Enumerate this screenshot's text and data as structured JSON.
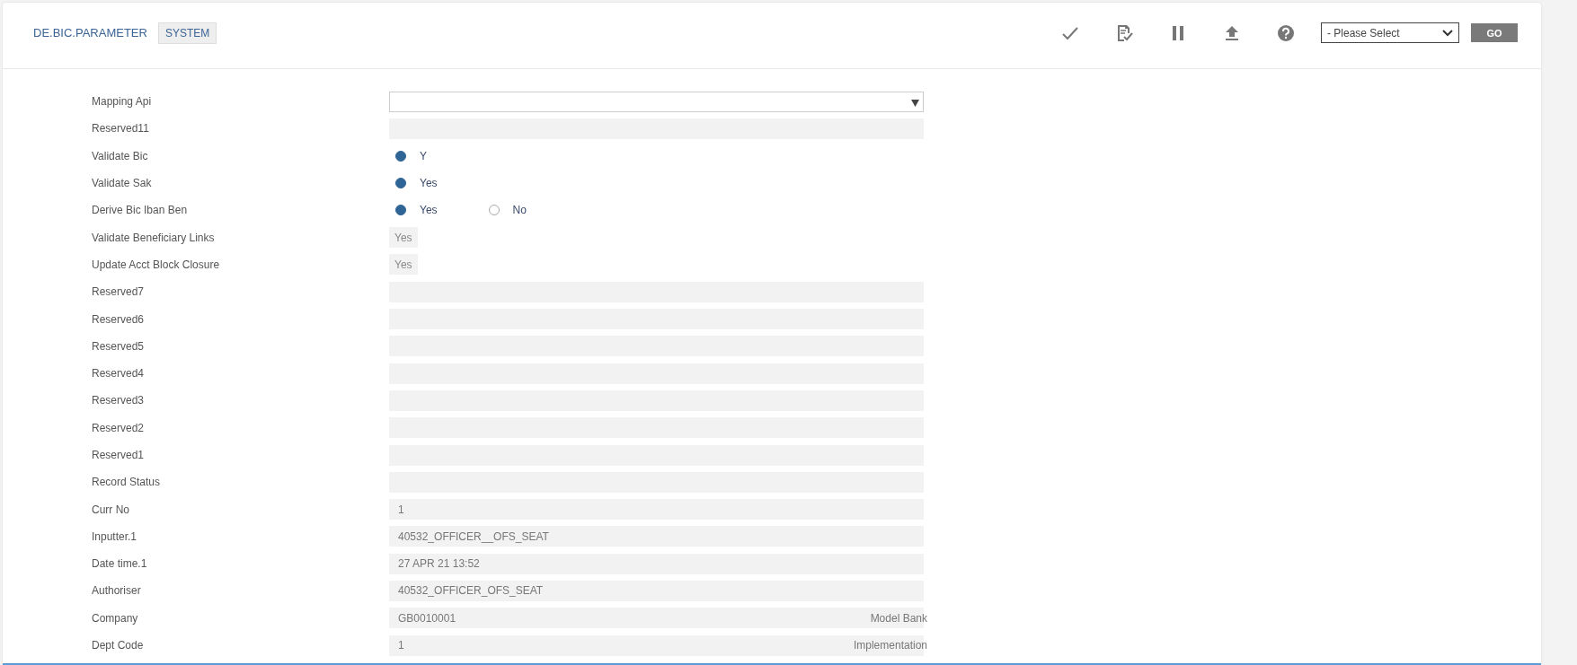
{
  "header": {
    "title": "DE.BIC.PARAMETER",
    "badge": "SYSTEM",
    "toolbar": [
      {
        "kind": "check"
      },
      {
        "kind": "doc-check"
      },
      {
        "kind": "pause"
      },
      {
        "kind": "upload"
      },
      {
        "kind": "help"
      }
    ],
    "select": {
      "placeholder": "- Please Select"
    },
    "go_button": "GO"
  },
  "fields": [
    {
      "label": "Mapping Api",
      "kind": "select"
    },
    {
      "label": "Reserved11",
      "kind": "text"
    },
    {
      "label": "Validate Bic",
      "kind": "radio",
      "options": [
        {
          "label": "Y",
          "selected": true
        }
      ]
    },
    {
      "label": "Validate Sak",
      "kind": "radio",
      "options": [
        {
          "label": "Yes",
          "selected": true
        }
      ]
    },
    {
      "label": "Derive Bic Iban Ben",
      "kind": "radio",
      "options": [
        {
          "label": "Yes",
          "selected": true
        },
        {
          "label": "No",
          "selected": false
        }
      ]
    },
    {
      "label": "Validate Beneficiary Links",
      "kind": "short",
      "value": "Yes"
    },
    {
      "label": "Update Acct Block Closure",
      "kind": "short",
      "value": "Yes"
    },
    {
      "label": "Reserved7",
      "kind": "text"
    },
    {
      "label": "Reserved6",
      "kind": "text"
    },
    {
      "label": "Reserved5",
      "kind": "text"
    },
    {
      "label": "Reserved4",
      "kind": "text"
    },
    {
      "label": "Reserved3",
      "kind": "text"
    },
    {
      "label": "Reserved2",
      "kind": "text"
    },
    {
      "label": "Reserved1",
      "kind": "text"
    },
    {
      "label": "Record Status",
      "kind": "text"
    },
    {
      "label": "Curr No",
      "kind": "text",
      "value": "1"
    },
    {
      "label": "Inputter.1",
      "kind": "text",
      "value": "40532_OFFICER__OFS_SEAT"
    },
    {
      "label": "Date time.1",
      "kind": "text",
      "value": "27 APR 21 13:52"
    },
    {
      "label": "Authoriser",
      "kind": "text",
      "value": "40532_OFFICER_OFS_SEAT"
    },
    {
      "label": "Company",
      "kind": "text",
      "value": "GB0010001",
      "enrichment": "Model Bank"
    },
    {
      "label": "Dept Code",
      "kind": "text",
      "value": "1",
      "enrichment": "Implementation"
    }
  ]
}
